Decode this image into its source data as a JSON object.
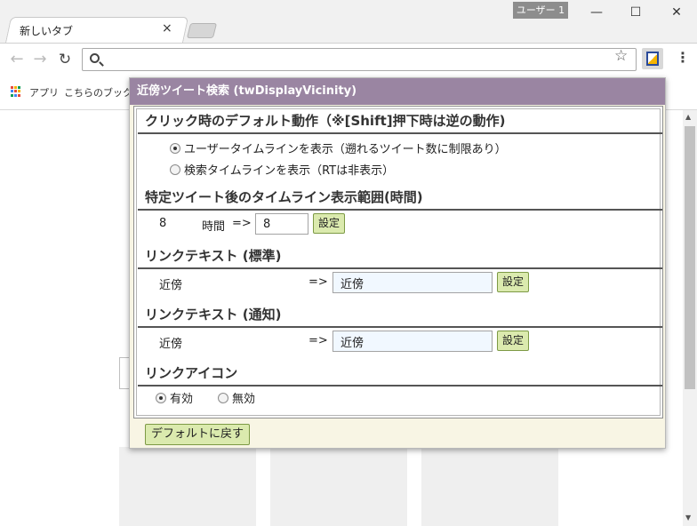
{
  "window": {
    "profile": "ユーザー 1",
    "minimize": "—",
    "maximize": "☐",
    "close": "✕"
  },
  "tab": {
    "title": "新しいタブ",
    "close": "×"
  },
  "toolbar": {
    "back": "←",
    "forward": "→",
    "reload": "↻",
    "omnibox_value": "",
    "star": "☆",
    "menu": "⋮"
  },
  "bookmarks": {
    "apps_label": "アプリ",
    "item": "こちらのブックマー",
    "apps_colors": [
      "#e64a3b",
      "#f4b400",
      "#0f9d58",
      "#4285f4",
      "#e64a3b",
      "#f4b400",
      "#0f9d58",
      "#4285f4",
      "#e64a3b"
    ]
  },
  "scroll": {
    "up": "▲",
    "down": "▼"
  },
  "popup": {
    "header": "近傍ツイート検索 (twDisplayVicinity)",
    "section_click": {
      "title": "クリック時のデフォルト動作（※[Shift]押下時は逆の動作)",
      "options": [
        {
          "label": "ユーザータイムラインを表示（遡れるツイート数に制限あり）",
          "checked": true
        },
        {
          "label": "検索タイムラインを表示（RTは非表示）",
          "checked": false
        }
      ]
    },
    "section_range": {
      "title": "特定ツイート後のタイムライン表示範囲(時間)",
      "current": "8",
      "unit": "時間",
      "arrow": "=>",
      "input_value": "8",
      "button": "設定"
    },
    "section_link_standard": {
      "title": "リンクテキスト (標準)",
      "current": "近傍",
      "arrow": "=>",
      "input_value": "近傍",
      "button": "設定"
    },
    "section_link_notify": {
      "title": "リンクテキスト (通知)",
      "current": "近傍",
      "arrow": "=>",
      "input_value": "近傍",
      "button": "設定"
    },
    "section_icon": {
      "title": "リンクアイコン",
      "options": [
        {
          "label": "有効",
          "checked": true
        },
        {
          "label": "無効",
          "checked": false
        }
      ]
    },
    "reset_button": "デフォルトに戻す"
  }
}
